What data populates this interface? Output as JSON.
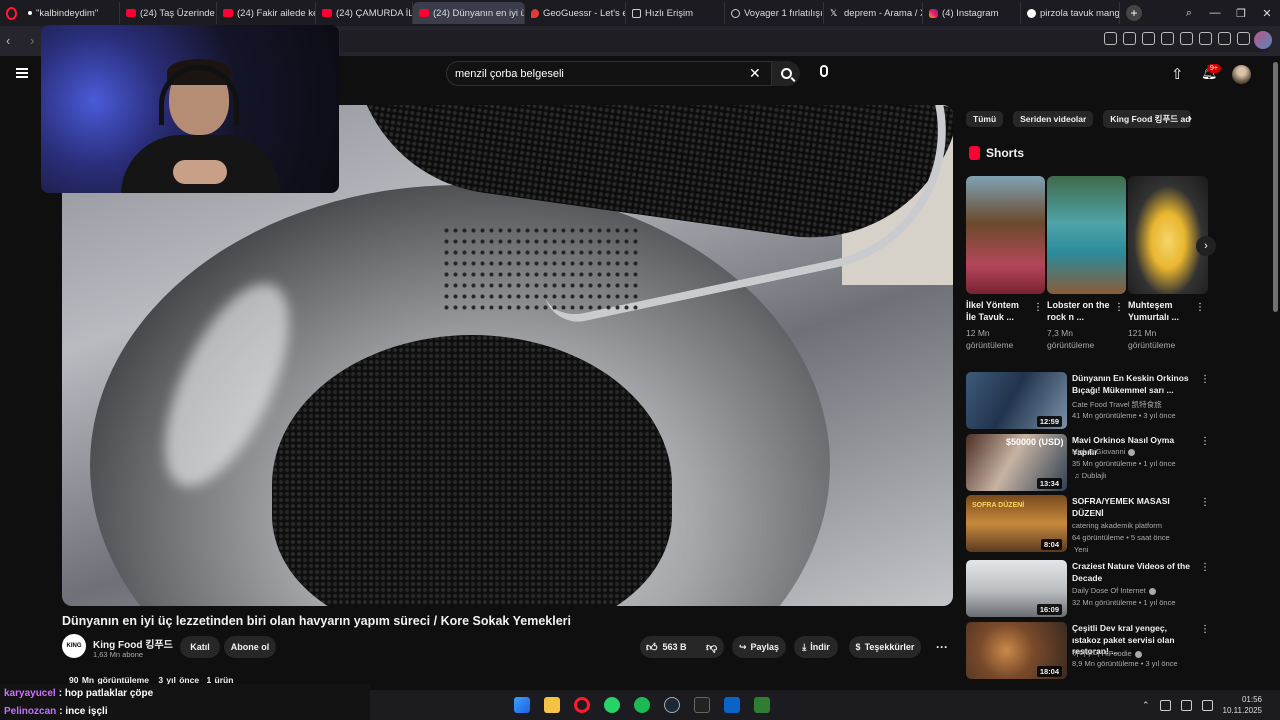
{
  "browser": {
    "tabs": [
      {
        "label": "\"kalbindeydim\"",
        "icon": "dot-icon"
      },
      {
        "label": "(24) Taş Üzerinde Rulo",
        "icon": "youtube-icon"
      },
      {
        "label": "(24) Fakir ailede kedi o",
        "icon": "youtube-icon"
      },
      {
        "label": "(24) ÇAMURDA İLİKLİ",
        "icon": "youtube-icon"
      },
      {
        "label": "(24) Dünyanın en iyi ü",
        "icon": "youtube-icon",
        "active": true
      },
      {
        "label": "GeoGuessr - Let's expl",
        "icon": "map-pin-icon"
      },
      {
        "label": "Hızlı Erişim",
        "icon": "grid-icon"
      },
      {
        "label": "Voyager 1 fırlatılışı",
        "icon": "globe-icon"
      },
      {
        "label": "deprem - Arama / X",
        "icon": "x-icon"
      },
      {
        "label": "(4) Instagram",
        "icon": "instagram-icon"
      },
      {
        "label": "pirzola tavuk mangal -",
        "icon": "google-icon"
      }
    ],
    "new_tab_symbol": "+",
    "window_controls": [
      "—",
      "❐",
      "✕"
    ]
  },
  "youtube": {
    "search": {
      "query": "menzil çorba belgeseli",
      "clear_symbol": "✕"
    },
    "notification_count": "9+",
    "video": {
      "title": "Dünyanın en iyi üç lezzetinden biri olan havyarın yapım süreci / Kore Sokak Yemekleri",
      "views": "90 Mn görüntüleme",
      "age": "3 yıl önce",
      "products": "1 ürün"
    },
    "channel": {
      "name": "King Food 킹푸드",
      "subscribers": "1,63 Mn abone",
      "avatar_text": "KING"
    },
    "actions": {
      "join": "Katıl",
      "subscribe": "Abone ol",
      "likes": "563 B",
      "share": "Paylaş",
      "download": "İndir",
      "thanks": "Teşekkürler",
      "more": "···"
    },
    "chips": [
      "Tümü",
      "Seriden videolar",
      "King Food 킹푸드 adı"
    ],
    "shorts_label": "Shorts",
    "shorts": [
      {
        "title": "İlkel Yöntem İle Tavuk ...",
        "views": "12 Mn görüntüleme"
      },
      {
        "title": "Lobster on the rock n ...",
        "views": "7,3 Mn görüntüleme"
      },
      {
        "title": "Muhteşem Yumurtalı ...",
        "views": "121 Mn görüntüleme"
      }
    ],
    "recommendations": [
      {
        "title": "Dünyanın En Keskin Orkinos Bıçağı! Mükemmel sarı ...",
        "channel": "Cate Food Travel 凯特食旅",
        "meta": "41 Mn görüntüleme • 3 yıl önce",
        "duration": "12:59",
        "verified": false,
        "badge": ""
      },
      {
        "title": "Mavi Orkinos Nasıl Oyma Yapılır",
        "channel": "Nick DiGiovanni",
        "meta": "35 Mn görüntüleme • 1 yıl önce",
        "duration": "13:34",
        "verified": true,
        "badge": "Dublajlı",
        "thumb_text": "$50000 (USD)"
      },
      {
        "title": "SOFRA/YEMEK MASASI DÜZENİ",
        "channel": "catering akademik platform",
        "meta": "64 görüntüleme • 5 saat önce",
        "duration": "8:04",
        "verified": false,
        "badge": "Yeni",
        "thumb_text": "SOFRA DÜZENİ"
      },
      {
        "title": "Craziest Nature Videos of the Decade",
        "channel": "Daily Dose Of Internet",
        "meta": "32 Mn görüntüleme • 1 yıl önce",
        "duration": "16:09",
        "verified": true,
        "badge": ""
      },
      {
        "title": "Çeşitli Dev kral yengeç, ıstakoz paket servisi olan restoran! ...",
        "channel": "하이푸디 HiFoodie",
        "meta": "8,9 Mn görüntüleme • 3 yıl önce",
        "duration": "18:04",
        "verified": true,
        "badge": ""
      }
    ]
  },
  "chat": [
    {
      "user": "karyayucel",
      "message": ": hop patlaklar çöpe"
    },
    {
      "user": "Pelinozcan",
      "message": ": ince işçli"
    }
  ],
  "taskbar": {
    "time": "01:56",
    "date": "10.11.2025"
  }
}
